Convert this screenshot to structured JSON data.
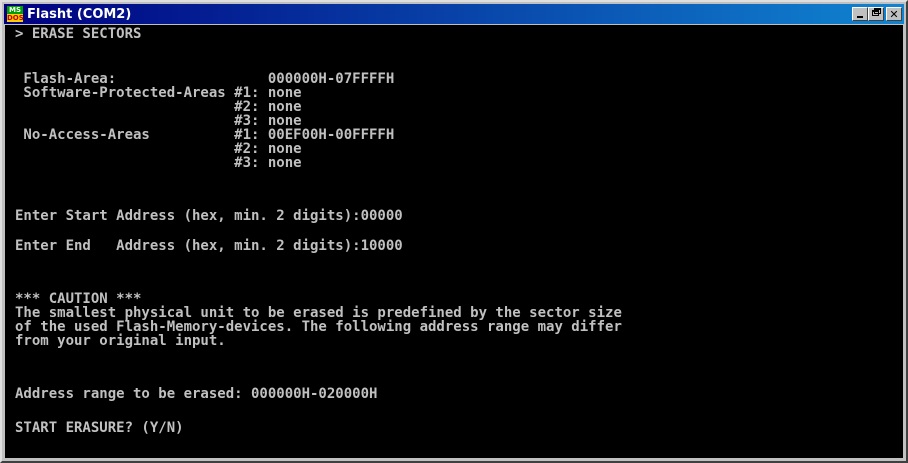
{
  "window": {
    "title": "Flasht (COM2)",
    "icon_name": "msdos-icon"
  },
  "terminal": {
    "lines": [
      "> ERASE SECTORS",
      " Flash-Area:                  000000H-07FFFFH",
      " Software-Protected-Areas #1: none",
      "                          #2: none",
      "                          #3: none",
      " No-Access-Areas          #1: 00EF00H-00FFFFH",
      "                          #2: none",
      "                          #3: none",
      "Enter Start Address (hex, min. 2 digits):00000",
      "Enter End   Address (hex, min. 2 digits):10000",
      "*** CAUTION ***",
      "The smallest physical unit to be erased is predefined by the sector size",
      "of the used Flash-Memory-devices. The following address range may differ",
      "from your original input.",
      "Address range to be erased: 000000H-020000H",
      "START ERASURE? (Y/N)"
    ]
  },
  "colors": {
    "titlebar": "#000080",
    "terminal_bg": "#000000",
    "terminal_fg": "#c0c0c0"
  }
}
